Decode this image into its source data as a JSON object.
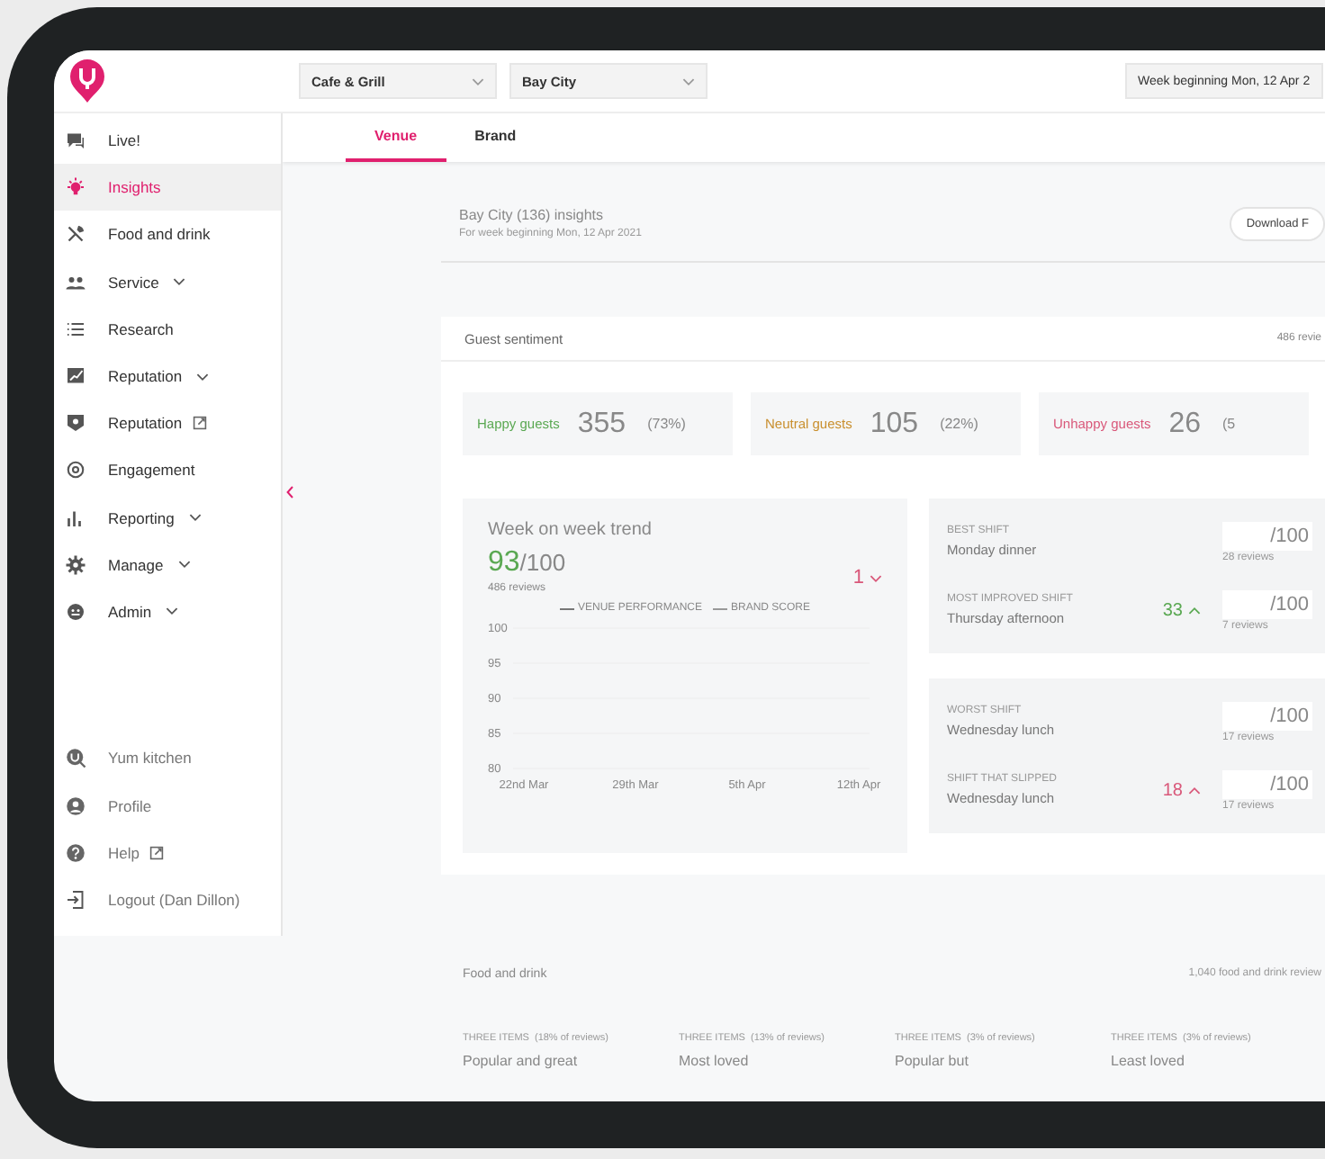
{
  "header": {
    "dropdowns": [
      {
        "value": "Cafe & Grill"
      },
      {
        "value": "Bay City"
      }
    ],
    "week": "Week beginning Mon, 12 Apr 2"
  },
  "sidebar": {
    "items": [
      {
        "label": "Live!",
        "kind": "page",
        "selected": false
      },
      {
        "label": "Insights",
        "kind": "page",
        "selected": true
      },
      {
        "label": "Food and drink",
        "kind": "page",
        "selected": false
      },
      {
        "label": "Service",
        "kind": "group",
        "selected": false
      },
      {
        "label": "Research",
        "kind": "page",
        "selected": false
      },
      {
        "label": "Reputation",
        "kind": "group",
        "selected": false
      },
      {
        "label": "Reputation",
        "kind": "external",
        "selected": false
      },
      {
        "label": "Engagement",
        "kind": "page",
        "selected": false
      },
      {
        "label": "Reporting",
        "kind": "group",
        "selected": false
      },
      {
        "label": "Manage",
        "kind": "group",
        "selected": false
      },
      {
        "label": "Admin",
        "kind": "group",
        "selected": false
      }
    ],
    "account_items": [
      {
        "label": "Yum kitchen",
        "kind": "page"
      },
      {
        "label": "Profile",
        "kind": "page"
      },
      {
        "label": "Help",
        "kind": "external"
      },
      {
        "label": "Logout (Dan Dillon)",
        "kind": "page"
      }
    ]
  },
  "tabs": [
    {
      "label": "Venue",
      "selected": true
    },
    {
      "label": "Brand",
      "selected": false
    }
  ],
  "insights": {
    "title": "Bay City (136) insights",
    "subtitle": "For week beginning Mon, 12 Apr 2021",
    "button": "Download F"
  },
  "guest_sentiment": {
    "title": "Guest sentiment",
    "count": "486 revie",
    "stats": [
      {
        "label": "Happy guests",
        "value": "355",
        "percent": "(73%)",
        "color": "#5aa852"
      },
      {
        "label": "Neutral guests",
        "value": "105",
        "percent": "(22%)",
        "color": "#c98f2e"
      },
      {
        "label": "Unhappy guests",
        "value": "26",
        "percent": "(5",
        "color": "#d9587a"
      }
    ],
    "trend": {
      "title": "Week on week trend",
      "score": "93",
      "out_of": "/100",
      "reviews": "486 reviews",
      "change": "1",
      "up": false,
      "chart_data": {
        "type": "line",
        "categories": [
          "22nd Mar",
          "29th Mar",
          "5th Apr",
          "12th Apr"
        ],
        "yticks": [
          80,
          85,
          90,
          95,
          100
        ],
        "ylim": [
          80,
          100
        ],
        "grid": true,
        "series": [
          {
            "name": "VENUE PERFORMANCE",
            "color": "#777777",
            "values": [
              null,
              null,
              null,
              null
            ]
          },
          {
            "name": "BRAND SCORE",
            "color": "#999999",
            "values": [
              null,
              null,
              null,
              null
            ]
          }
        ]
      }
    },
    "shift_panels": [
      {
        "shifts": [
          {
            "label": "BEST SHIFT",
            "name": "Monday dinner",
            "score": "/100",
            "reviews": "28 reviews"
          },
          {
            "label": "MOST IMPROVED SHIFT",
            "name": "Thursday afternoon",
            "change": "33",
            "up": true,
            "color": "#5aa852",
            "score": "/100",
            "reviews": "7 reviews"
          }
        ]
      },
      {
        "shifts": [
          {
            "label": "WORST SHIFT",
            "name": "Wednesday lunch",
            "score": "/100",
            "reviews": "17 reviews"
          },
          {
            "label": "SHIFT THAT SLIPPED",
            "name": "Wednesday lunch",
            "change": "18",
            "up": true,
            "color": "#d9587a",
            "score": "/100",
            "reviews": "17 reviews"
          }
        ]
      }
    ]
  },
  "food_and_drink": {
    "title": "Food and drink",
    "count": "1,040 food and drink review",
    "columns": [
      {
        "label": "THREE ITEMS",
        "note": "(18% of reviews)",
        "title": "Popular and great"
      },
      {
        "label": "THREE ITEMS",
        "note": "(13% of reviews)",
        "title": "Most loved"
      },
      {
        "label": "THREE ITEMS",
        "note": "(3% of reviews)",
        "title": "Popular but"
      },
      {
        "label": "THREE ITEMS",
        "note": "(3% of reviews)",
        "title": "Least loved"
      }
    ]
  }
}
